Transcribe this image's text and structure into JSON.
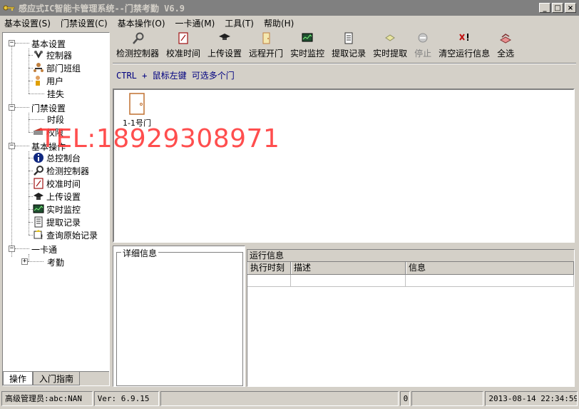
{
  "window": {
    "title": "感应式IC智能卡管理系统--门禁考勤 V6.9",
    "buttons": {
      "minimize": "_",
      "maximize": "□",
      "close": "×"
    }
  },
  "menubar": [
    "基本设置(S)",
    "门禁设置(C)",
    "基本操作(O)",
    "一卡通(M)",
    "工具(T)",
    "帮助(H)"
  ],
  "tree": {
    "group1": {
      "label": "基本设置",
      "items": [
        "控制器",
        "部门班组",
        "用户",
        "挂失"
      ]
    },
    "group2": {
      "label": "门禁设置",
      "items": [
        "时段",
        "权限"
      ]
    },
    "group3": {
      "label": "基本操作",
      "items": [
        "总控制台",
        "检测控制器",
        "校准时间",
        "上传设置",
        "实时监控",
        "提取记录",
        "查询原始记录"
      ]
    },
    "group4": {
      "label": "一卡通",
      "items": [
        "考勤"
      ]
    }
  },
  "tabs": [
    "操作",
    "入门指南"
  ],
  "toolbar": [
    {
      "label": "检测控制器",
      "icon": "detect-icon",
      "disabled": false
    },
    {
      "label": "校准时间",
      "icon": "clock-icon",
      "disabled": false
    },
    {
      "label": "上传设置",
      "icon": "upload-icon",
      "disabled": false
    },
    {
      "label": "远程开门",
      "icon": "remote-open-icon",
      "disabled": false
    },
    {
      "label": "实时监控",
      "icon": "monitor-icon",
      "disabled": false
    },
    {
      "label": "提取记录",
      "icon": "extract-icon",
      "disabled": false
    },
    {
      "label": "实时提取",
      "icon": "realtime-extract-icon",
      "disabled": false
    },
    {
      "label": "停止",
      "icon": "stop-icon",
      "disabled": true
    },
    {
      "label": "清空运行信息",
      "icon": "clear-icon",
      "disabled": false
    },
    {
      "label": "全选",
      "icon": "select-all-icon",
      "disabled": false
    }
  ],
  "hint": "CTRL + 鼠标左键 可选多个门",
  "doors": [
    {
      "label": "1-1号门"
    }
  ],
  "watermark": "TEL:18929308971",
  "detail": {
    "title": "详细信息"
  },
  "runinfo": {
    "caption": "运行信息",
    "columns": [
      "执行时刻",
      "描述",
      "信息"
    ]
  },
  "status": {
    "user": "高级管理员:abc:NAN",
    "version": "Ver: 6.9.15",
    "blank1": "",
    "count": "0",
    "blank2": "",
    "datetime": "2013-08-14 22:34:59"
  }
}
